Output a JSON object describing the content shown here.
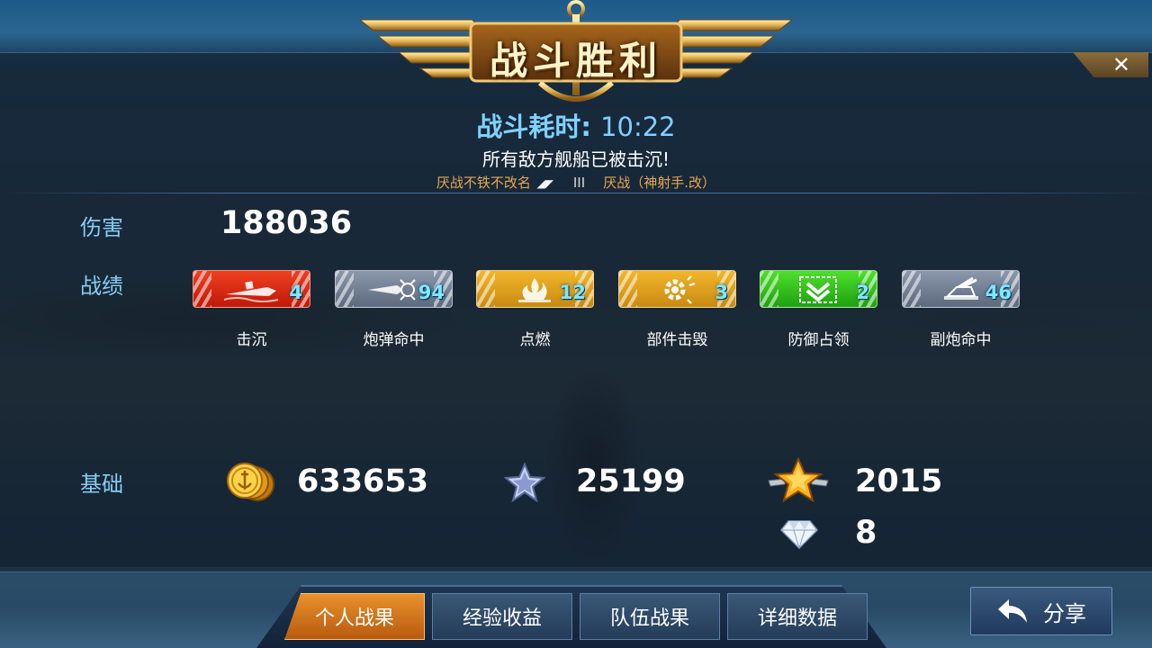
{
  "banner": {
    "title": "战斗胜利"
  },
  "close": {
    "icon": "close-icon",
    "glyph": "✕"
  },
  "header": {
    "duration_label": "战斗耗时:",
    "duration_value": "10:22",
    "result_message": "所有敌方舰船已被击沉!",
    "player_name": "厌战不铁不改名",
    "tier": "III",
    "ship_name": "厌战（神射手.改）"
  },
  "damage": {
    "label": "伤害",
    "value": "188036"
  },
  "record": {
    "label": "战绩",
    "medals": [
      {
        "name": "击沉",
        "count": "4",
        "icon": "sinking-ship-icon",
        "color": "red"
      },
      {
        "name": "炮弹命中",
        "count": "94",
        "icon": "shell-hit-icon",
        "color": "gray"
      },
      {
        "name": "点燃",
        "count": "12",
        "icon": "fire-icon",
        "color": "gold"
      },
      {
        "name": "部件击毁",
        "count": "3",
        "icon": "gear-burst-icon",
        "color": "gold"
      },
      {
        "name": "防御占领",
        "count": "2",
        "icon": "chevron-shield-icon",
        "color": "green"
      },
      {
        "name": "副炮命中",
        "count": "46",
        "icon": "secondary-gun-icon",
        "color": "gray"
      }
    ]
  },
  "base": {
    "label": "基础",
    "coins": "633653",
    "ship_exp": "25199",
    "captain_exp": "2015",
    "diamonds": "8"
  },
  "tabs": [
    {
      "label": "个人战果",
      "active": true
    },
    {
      "label": "经验收益",
      "active": false
    },
    {
      "label": "队伍战果",
      "active": false
    },
    {
      "label": "详细数据",
      "active": false
    }
  ],
  "share": {
    "label": "分享",
    "icon": "share-arrow-icon"
  }
}
